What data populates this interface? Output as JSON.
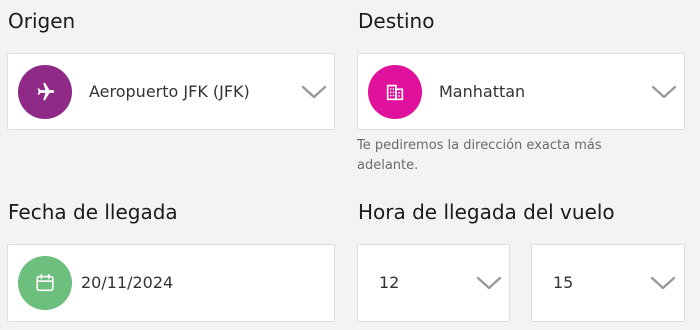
{
  "origin": {
    "label": "Origen",
    "value": "Aeropuerto JFK (JFK)",
    "icon": "airplane-icon",
    "icon_color": "#8e2a86"
  },
  "destination": {
    "label": "Destino",
    "value": "Manhattan",
    "icon": "building-icon",
    "icon_color": "#e0119a",
    "hint": "Te pediremos la dirección exacta más adelante."
  },
  "arrival_date": {
    "label": "Fecha de llegada",
    "value": "20/11/2024",
    "icon": "calendar-icon",
    "icon_color": "#6cbf7c"
  },
  "arrival_time": {
    "label": "Hora de llegada del vuelo",
    "hour": "12",
    "minute": "15"
  }
}
